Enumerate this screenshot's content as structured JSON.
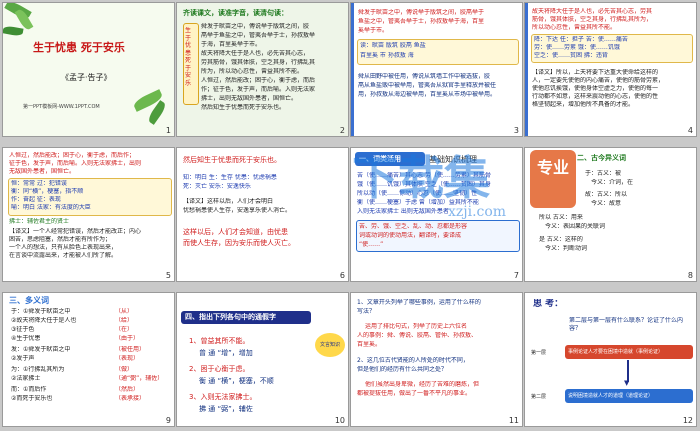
{
  "slides": [
    {
      "num": "1",
      "title": "生于忧患 死于安乐",
      "author": "《孟子·告子》",
      "footer": "第一PPT模板网-WWW.1PPT.COM"
    },
    {
      "num": "2",
      "heading": "齐读课文，读准字音，读清句读：",
      "side": "生于忧患死于安乐",
      "lines": [
        "舜发于畎亩之中，傅说举于版筑之间，胶",
        "鬲举于鱼盐之中，管夷吾举于士，孙叔敖举",
        "于海，百里奚举于市。",
        "故天将降大任于是人也，必先苦其心志，",
        "劳其筋骨，饿其体肤，空乏其身，行拂乱其",
        "所为，所以动心忍性，曾益其所不能。",
        "人恒过，然后能改；困于心，衡于虑，而后",
        "作；征于色，发于声，而后喻。入则无法家",
        "拂士，出则无敌国外患者，国恒亡。",
        "然后知生于忧患而死于安乐也。"
      ]
    },
    {
      "num": "3",
      "lines": [
        "舜发于畎亩之中，傅说举于版筑之间，胶鬲举于",
        "鱼盐之中，管夷吾举于士，孙叔敖举于海，百里",
        "奚举于市。",
        "读：畎亩 版筑 胶鬲 鱼盐",
        "百里奚 市 孙叔敖 海",
        "舜从田野中被任用，傅说从筑墙工作中被选拔，胶",
        "鬲从鱼盐贩中被举用，管夷吾从狱官手里释放并被任",
        "用，孙叔敖从海边被举用，百里奚从市场中被举用。"
      ]
    },
    {
      "num": "4",
      "lines": [
        "故天将降大任于是人也，必先苦其心志，劳其",
        "筋骨，饿其体肤，空乏其身，行拂乱其所为，",
        "所以动心忍性，曾益其所不能。",
        "降：下达 任：担子 苦：使……痛苦",
        "劳：使……劳累 饿：使……饥饿",
        "空乏：使……贫困 拂：违背",
        "【译文】所以，上天将要下达重大使命给这样的",
        "人，一定要先使他的内心痛苦，使他的筋骨劳累，",
        "使他忍饥挨饿，使他身体空虚乏力，使他的每一",
        "行动都不如意，这样来震动他的心志，使他的性",
        "格坚韧起来，增加他所不具备的才能。"
      ]
    },
    {
      "num": "5",
      "lines": [
        "人恒过，然后能改；困于心，衡于虑，而后作；",
        "征于色，发于声，而后喻。入则无法家拂士，出则",
        "无敌国外患者，国恒亡。",
        "恒：常常 过：犯错误",
        "衡：同“横”，梗塞，指不顺",
        "作：奋起 征：表现",
        "喻：明白 法家：有法度的大臣",
        "拂士：辅佐君主的贤士",
        "【译文】一个人经常犯错误，然后才能改正；内心",
        "困苦，思虑阻塞，然后才能有所作为；",
        "一个人的想法，只有从脸色上表现出来，",
        "在言谈中流露出来，才能被人们所了解。"
      ]
    },
    {
      "num": "6",
      "lines": [
        "然后知生于忧患而死于安乐也。",
        "知：明白 生：生存 忧患：忧虑祸患",
        "死：灭亡 安乐：安逸快乐",
        "【译文】这样以后，人们才会明白",
        "忧愁祸患使人生存，安逸享乐使人消亡。",
        "这样以后，人们才会知道，由忧患",
        "而使人生存，因为安乐而使人灭亡。"
      ]
    },
    {
      "num": "7",
      "heading": "一、词类活用",
      "heading2": "基础知识梳理",
      "lines": [
        "苦（使……痛苦）其心志 劳（使……劳累）其筋骨",
        "饿（使……饥饿）其体肤 空乏（使……贫困）其身",
        "所以动（使……惊动）心忍（使……坚韧）性",
        "衡（使……梗塞）于虑 曾（增加）益其所不能",
        "入则无法家拂士 出则无敌国外患者",
        "苦、劳、饿、空乏、乱、动、忍都是形容",
        "词或动词的使动用法，翻译时，要译成",
        "“使……”"
      ]
    },
    {
      "num": "8",
      "heading": "二、古今异义词",
      "lines": [
        "于：古义：被",
        "　今义：介词，在",
        "故：古义：所以",
        "　今义：故意",
        "所以 古义：用来",
        "　今义：表因果的关联词",
        "是 古义：这样的",
        "　今义：判断动词"
      ]
    },
    {
      "num": "9",
      "heading": "三、多义词",
      "lines": [
        "于：①舜发于畎亩之中",
        "②故天将降大任于是人也",
        "③征于色",
        "④生于忧患",
        "发：①舜发于畎亩之中",
        "②发于声",
        "为：①行拂乱其所为",
        "②法家拂士",
        "而：①而后作",
        "②而死于安乐也"
      ],
      "notes": [
        "（从）",
        "（给）",
        "（在）",
        "（由于）",
        "（被任用）",
        "（表现）",
        "（做）",
        "（通“弼”，辅佐）",
        "（然后）",
        "（表承接）"
      ]
    },
    {
      "num": "10",
      "heading": "四、指出下列各句中的通假字",
      "lines": [
        "1、曾益其所不能。",
        "曾 通 “增”，增加",
        "2、困于心衡于虑。",
        "衡 通 “横”，梗塞，不顺",
        "3、入则无法家拂士。",
        "拂 通 “弼”，辅佐"
      ],
      "badge": "文言知识"
    },
    {
      "num": "11",
      "lines": [
        "1、文章开头列举了哪些事例，运用了什么样的",
        "写法？",
        "运用了排比句式，列举了历史上六位名",
        "人的事例：舜、傅说、胶鬲、管仲、孙叔敖、",
        "百里奚。",
        "2、这几位古代贤能的人所处的时代不同，",
        "但是他们的经历有什么共同之处？",
        "他们虽然出身卑微，经历了苦难的磨炼，但",
        "都被提拔任用，做出了一番不平凡的事业。"
      ]
    },
    {
      "num": "12",
      "heading": "思 考：",
      "question": "第二层与第一层有什么联系？论证了什么内容？",
      "box1": "事例论证人才要在困境中造就（事例论证）",
      "box2": "说明困境造就人才的道理（道理论证）",
      "tag1": "第一层",
      "tag2": "第二层"
    }
  ],
  "watermark": {
    "text": "下载集",
    "badge": "专业",
    "url": "xzji.com"
  }
}
